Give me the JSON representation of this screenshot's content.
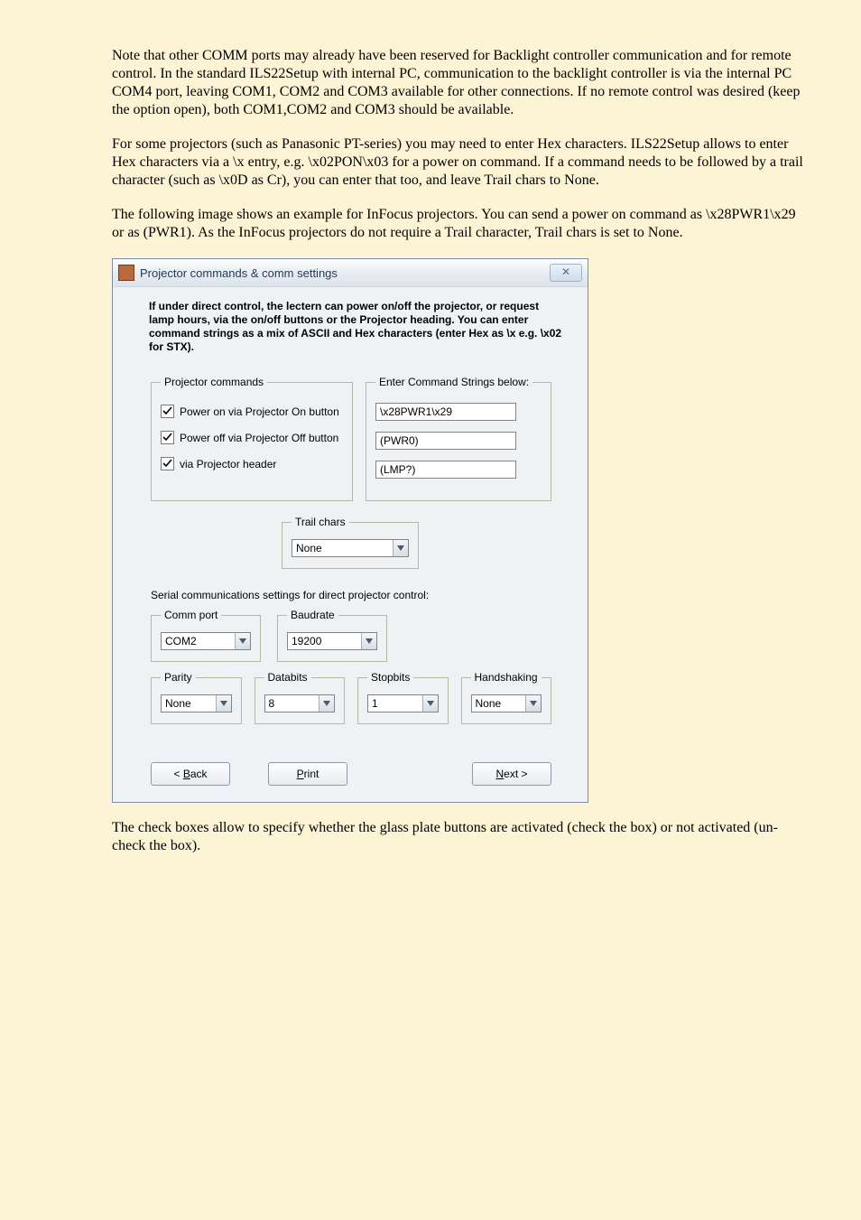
{
  "para1": "Note that other COMM ports may already have been reserved for Backlight controller communication and for remote control. In the standard ILS22Setup with internal PC, communication to the backlight controller is via the internal PC COM4 port, leaving COM1, COM2 and COM3 available for other connections. If no remote control was desired (keep the option open), both COM1,COM2 and COM3 should be available.",
  "para2": "For some projectors (such as Panasonic PT-series) you may need to enter Hex characters. ILS22Setup allows to enter Hex characters via a \\x entry, e.g. \\x02PON\\x03 for a power on command. If a command needs to be followed by a trail character (such as \\x0D as Cr), you can enter that too, and leave Trail chars to None.",
  "para3": "The following image shows an example for InFocus projectors. You can send a power on command as \\x28PWR1\\x29 or as (PWR1). As the InFocus projectors do not require a Trail character, Trail chars is set to None.",
  "para4": "The check boxes allow to specify whether the glass plate buttons are activated (check the box) or not activated (un-check the box).",
  "window": {
    "title": "Projector commands & comm settings",
    "intro": "If under direct control, the lectern can power on/off the projector, or request lamp hours, via the on/off buttons or the Projector heading. You can enter command strings as a mix of ASCII and Hex characters (enter Hex as \\x e.g. \\x02 for STX).",
    "fs_commands": {
      "legend": "Projector commands",
      "chk_on": "Power on via Projector On button",
      "chk_off": "Power off via Projector Off button",
      "chk_header": "via Projector header"
    },
    "fs_enter": {
      "legend": "Enter Command Strings below:",
      "val_on": "\\x28PWR1\\x29",
      "val_off": "(PWR0)",
      "val_lmp": "(LMP?)"
    },
    "trail": {
      "legend": "Trail chars",
      "value": "None"
    },
    "serial_label": "Serial communications settings for direct projector control:",
    "comm": {
      "commport": {
        "legend": "Comm port",
        "value": "COM2"
      },
      "baudrate": {
        "legend": "Baudrate",
        "value": "19200"
      },
      "parity": {
        "legend": "Parity",
        "value": "None"
      },
      "databits": {
        "legend": "Databits",
        "value": "8"
      },
      "stopbits": {
        "legend": "Stopbits",
        "value": "1"
      },
      "handshake": {
        "legend": "Handshaking",
        "value": "None"
      }
    },
    "buttons": {
      "back_u": "B",
      "back_rest": "ack",
      "print_u": "P",
      "print_rest": "rint",
      "next_u": "N",
      "next_rest": "ext >"
    }
  }
}
